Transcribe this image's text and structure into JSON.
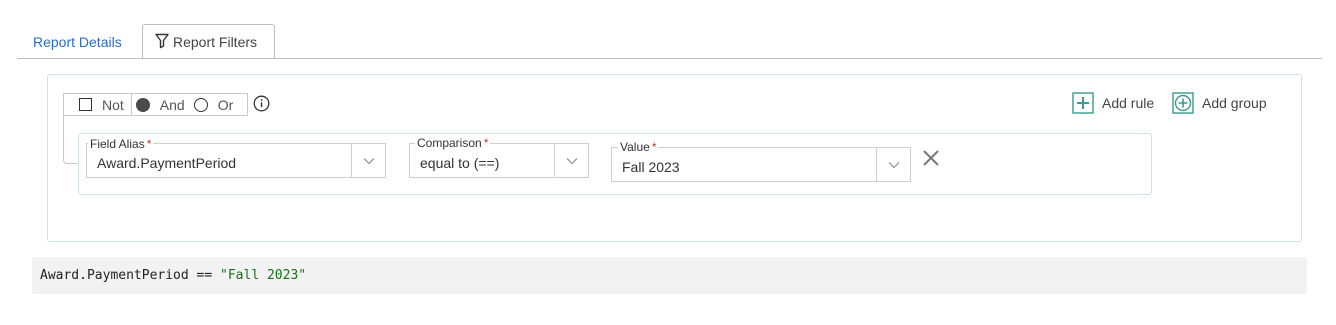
{
  "tabs": [
    {
      "label": "Report Details",
      "active": false,
      "icon": "none"
    },
    {
      "label": "Report Filters",
      "active": true,
      "icon": "funnel-icon"
    }
  ],
  "group": {
    "conjunctions": {
      "not_label": "Not",
      "not_checked": false,
      "and_label": "And",
      "or_label": "Or",
      "selected": "And"
    },
    "add_rule_label": "Add rule",
    "add_group_label": "Add group"
  },
  "rule": {
    "field_alias_label": "Field Alias",
    "field_alias_value": "Award.PaymentPeriod",
    "comparison_label": "Comparison",
    "comparison_value": "equal to (==)",
    "value_label": "Value",
    "value_value": "Fall 2023",
    "required_marker": "*"
  },
  "expression": {
    "left": "Award.PaymentPeriod == ",
    "string": "\"Fall 2023\""
  },
  "colors": {
    "link": "#2a6ebb",
    "accent_teal": "#3a9a8f",
    "required": "#c0392b",
    "string_literal": "#1a6e1a",
    "group_border": "#cfe3e6"
  }
}
